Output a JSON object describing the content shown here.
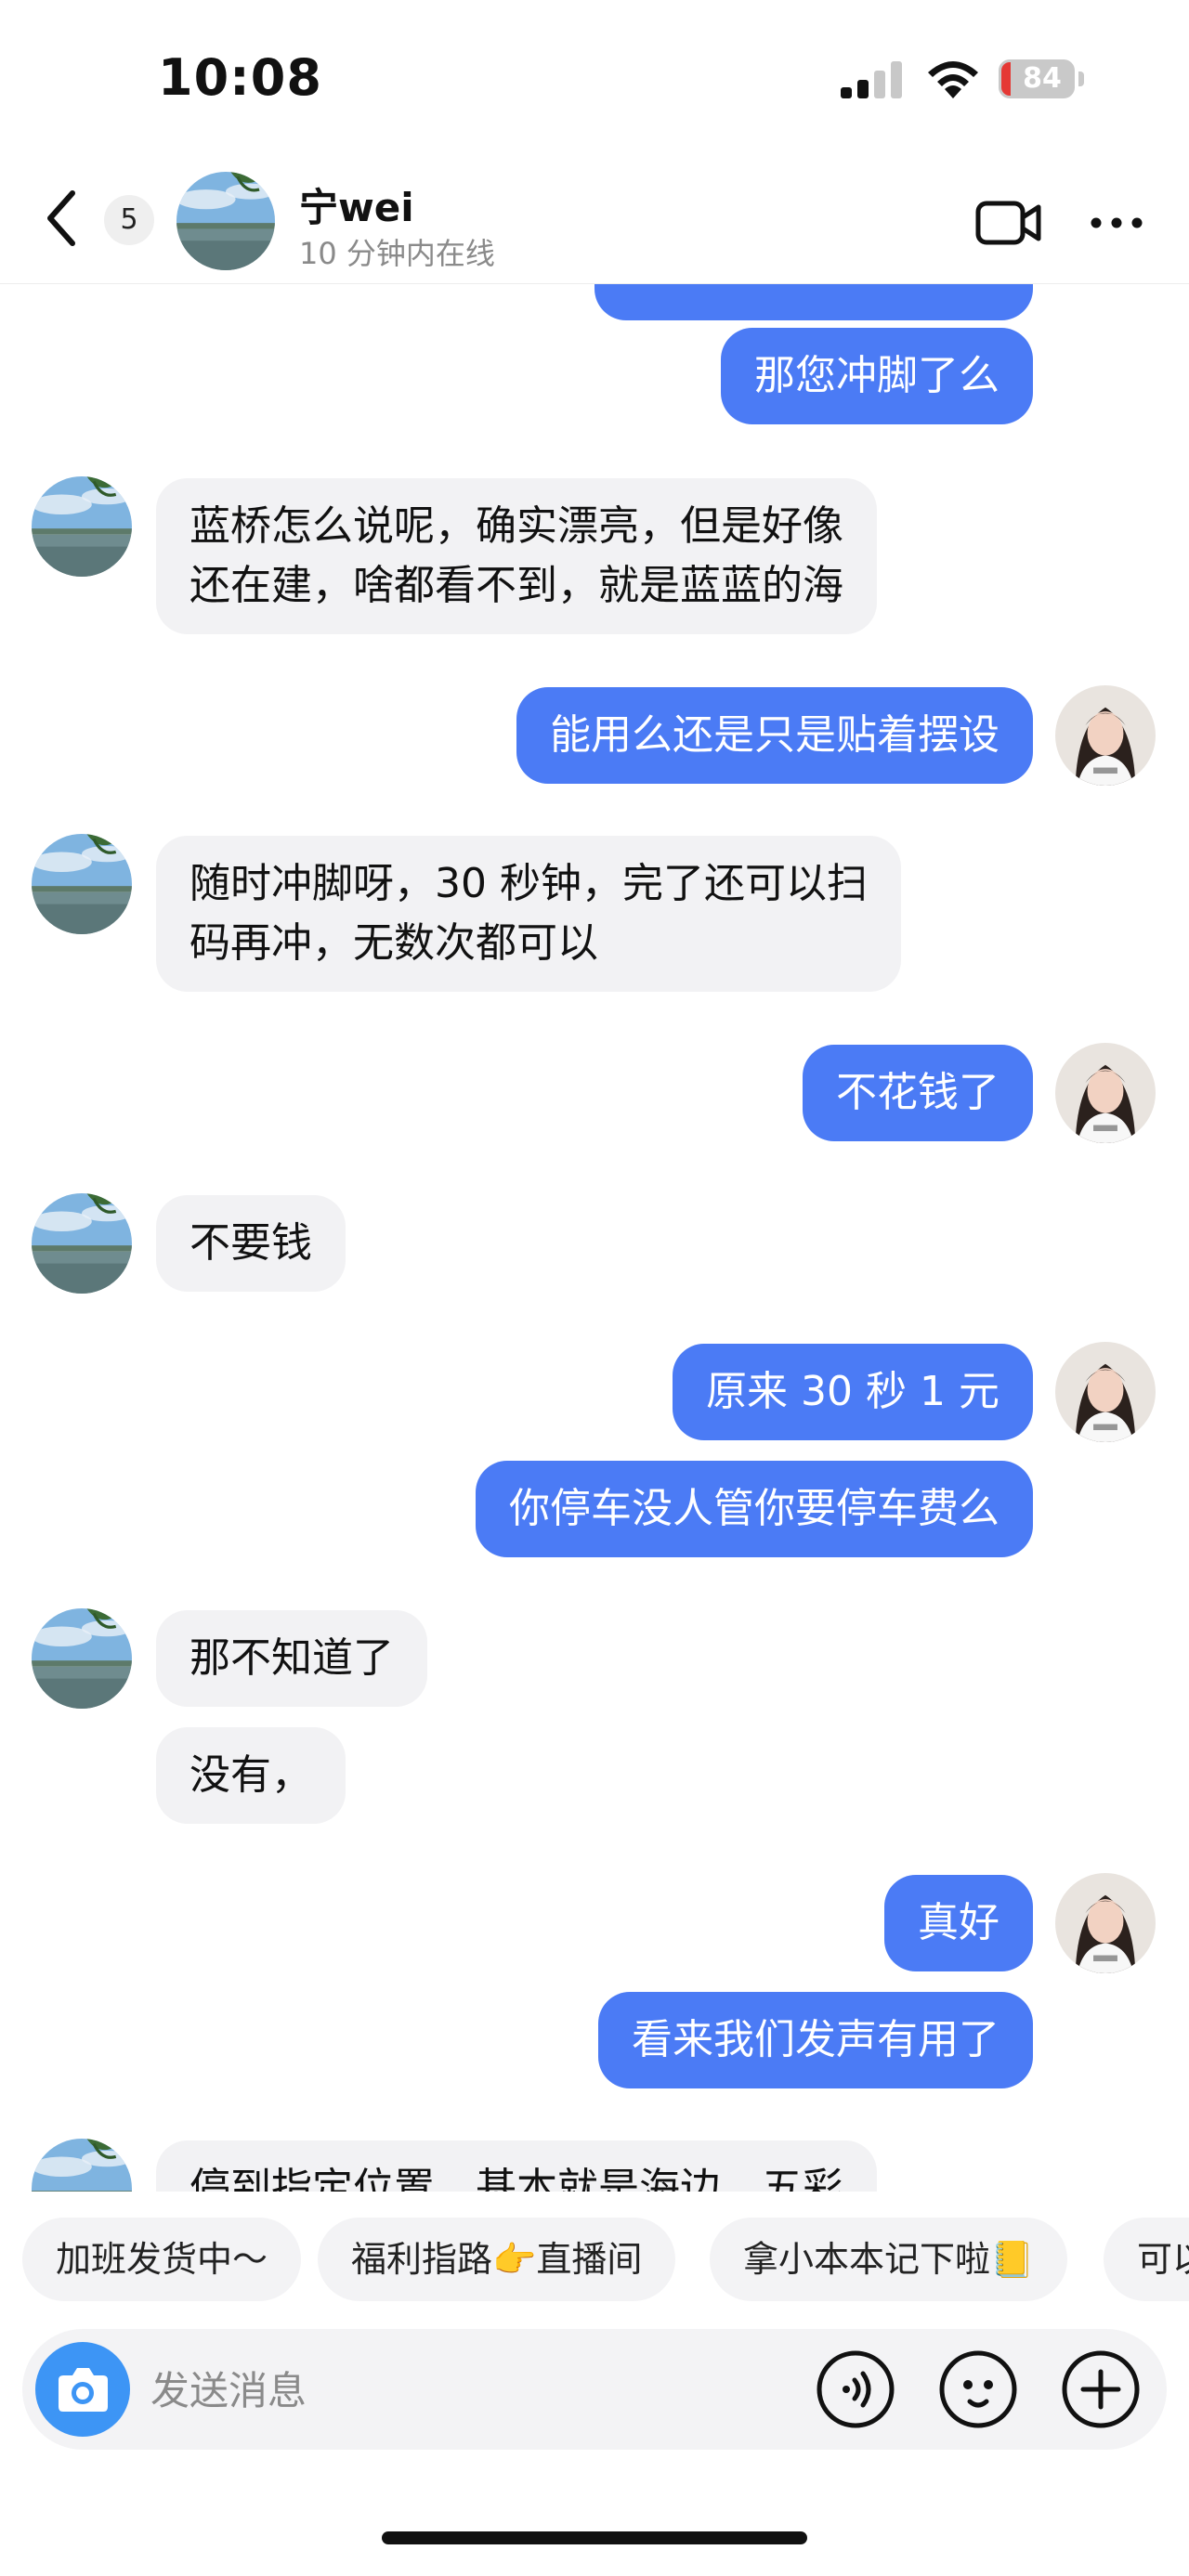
{
  "status_bar": {
    "time": "10:08",
    "battery": "84"
  },
  "header": {
    "unread_count": "5",
    "contact_name": "宁wei",
    "contact_status": "10 分钟内在线"
  },
  "messages": [
    {
      "side": "out",
      "text": "那您冲脚了么"
    },
    {
      "side": "in",
      "text": "蓝桥怎么说呢，确实漂亮，但是好像\n还在建，啥都看不到，就是蓝蓝的海"
    },
    {
      "side": "out",
      "text": "能用么还是只是贴着摆设"
    },
    {
      "side": "in",
      "text": "随时冲脚呀，30 秒钟，完了还可以扫\n码再冲，无数次都可以"
    },
    {
      "side": "out",
      "text": "不花钱了"
    },
    {
      "side": "in",
      "text": "不要钱"
    },
    {
      "side": "out",
      "text": "原来 30 秒 1 元"
    },
    {
      "side": "out",
      "text": "你停车没人管你要停车费么"
    },
    {
      "side": "in",
      "text": "那不知道了"
    },
    {
      "side": "in",
      "text": "没有，"
    },
    {
      "side": "out",
      "text": "真好"
    },
    {
      "side": "out",
      "text": "看来我们发声有用了"
    },
    {
      "side": "in",
      "text": "停到指定位置，基本就是海边，五彩"
    }
  ],
  "quick_replies": [
    "加班发货中～",
    "福利指路👉直播间",
    "拿小本本记下啦📒",
    "可以"
  ],
  "input": {
    "placeholder": "发送消息"
  },
  "colors": {
    "outgoing_bubble": "#4b7bf5",
    "incoming_bubble": "#f2f2f4",
    "camera_button": "#3d95f5"
  },
  "icons": [
    "back-icon",
    "video-call-icon",
    "more-icon",
    "camera-icon",
    "voice-icon",
    "emoji-icon",
    "plus-icon"
  ]
}
